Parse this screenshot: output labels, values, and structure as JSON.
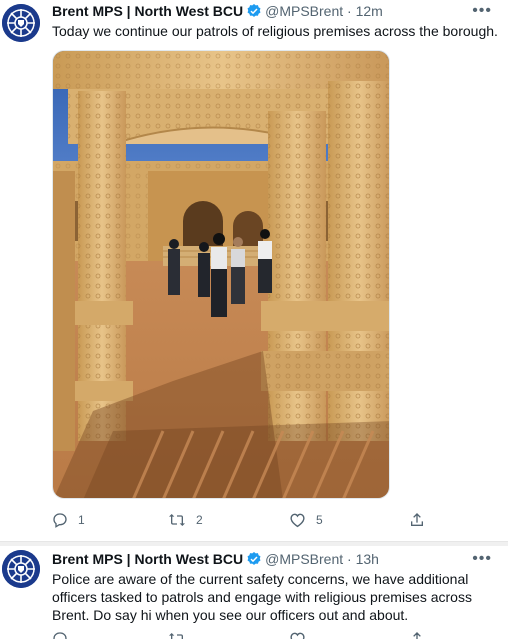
{
  "tweets": [
    {
      "author_name": "Brent MPS | North West BCU",
      "handle": "@MPSBrent",
      "separator": "·",
      "time": "12m",
      "text": "Today we continue our patrols of religious premises across the borough.",
      "more": "•••",
      "replies": "1",
      "retweets": "2",
      "likes": "5",
      "icons": {
        "reply": "reply-icon",
        "retweet": "retweet-icon",
        "like": "heart-icon",
        "share": "share-icon",
        "verified": "verified-badge-icon"
      }
    },
    {
      "author_name": "Brent MPS | North West BCU",
      "handle": "@MPSBrent",
      "separator": "·",
      "time": "13h",
      "text": "Police are aware of the current safety concerns, we have additional officers tasked to patrols and engage with religious premises across Brent. Do say hi when you see our officers out and about.",
      "more": "•••"
    }
  ],
  "colors": {
    "verified": "#1d9bf0",
    "muted": "#536471",
    "text": "#0f1419",
    "avatar": "#1b3a8c"
  }
}
